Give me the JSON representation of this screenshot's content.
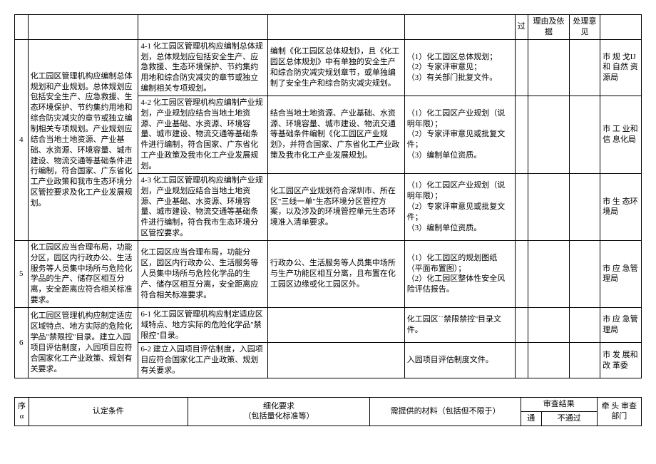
{
  "table1": {
    "head": {
      "pass": "过",
      "reason": "理由及依据",
      "opinion": "处理意见"
    },
    "rows": [
      {
        "seq": "4",
        "cond": "化工园区管理机构应编制总体规划和产业规划。总体规划应包括安全生产、应急救援、生态环境保护、节约集约用地和综合防灾减灾的章节或独立编制相关专项规划。产业规划应结合当地土地资源、产业基础、水资源、环境容量、城市建设、物流交通等基础条件进行编制，符合国家、广东省化工产业政策和我市生态环境分区管控要求及化工产业发展规划。",
        "sub": [
          {
            "detail": "4-1 化工园区管理机构应编制总体规划，总体规划应包括安全生产、应急救援、生态环境保护、节约集约用地和综合防灾减灾的章节或独立编制相关专项规划。",
            "mat": "编制《化工园区总体规划》，且《化工园区总体规划》中有单独的安全生产和综合防灾减灾规划章节，或单独编制了安全生产和综合防灾减灾规划。",
            "mat2": "（1）化工园区总体规划；\n（2）专家评审意见；\n（3）有关部门批复文件。",
            "dept": "市 规 戈IJ 和 自然 资 源局"
          },
          {
            "detail": "4-2 化工园区管理机构应编制产业规划，产业规划应结合当地土地资源、产业基础、水资源、环境容量、城市建设、物流交通等基础条件进行编制，符合国家、广东省化工产业政策及我市化工产业发展规划。",
            "mat": "结合当地土地资源、产业基础、水资源、环境容量、城市建设、物流交通等基础条件编制《化工园区产业规划》，并符合国家、广东省化工产业政策及我市化工产业发展规划。",
            "mat2": "（1）化工园区产业规划（说明年限）；\n（2）专家评审意见或批复文件；\n（3）编制单位资质。",
            "dept": "市 工 业和 信 息化局"
          },
          {
            "detail": "4-3 化工园区管理机构应编制产业规划，产业规划应结合当地土地资源、产业基础、水资源、环境容量、城市建设、物流交通等基础条件进行编制，符合我市生态环境分区管控要求。",
            "mat": "化工园区产业规划符合深圳市、所在区\"三线一单\"生态环境分区管控方案，以及涉及的环境管控单元生态环境准入清单要求。",
            "mat2": "（1）化工园区产业规划（说明年限）；\n（2）专家评审意见或批复文件；\n（3）编制单位资质。",
            "dept": "市 生 态环境局"
          }
        ]
      },
      {
        "seq": "5",
        "cond": "化工园区应当合理布局，功能分区，园区内行政办公、生活服务等人员集中场所与危险化学品的生产、储存区相互分离，安全距离应符合相关标准要求。",
        "detail": "化工园区应当合理布局，功能分区，园区内行政办公、生活服务等人员集中场所与危险化学品的生产、储存区相互分离，安全距离应符合相关标准要求。",
        "mat": "行政办公、生活服务等人员集中场所与生产功能区相互分离，且布置在化工园区边缘或化工园区外。",
        "mat2": "（1）化工园区的规划图纸（平面布置图）；\n（2）化工园区整体性安全风险评估报告。",
        "dept": "市 应 急管理局"
      },
      {
        "seq": "6",
        "cond": "化工园区管理机构应制定适应区域特点、地方实际的危险化学品\"禁限控\"目录。建立入园项目评估制度，入园项目应符合国家化工产业政策、规划有关要求。",
        "sub": [
          {
            "detail": "6-1 化工园区管理机构应制定适应区域特点、地方实际的危险化学品\"禁限控\"目录。",
            "mat": "",
            "mat2": "化工园区``禁限禁控''目录文件。",
            "dept": "市 应 急管理局"
          },
          {
            "detail": "6-2 建立入园项目评估制度，入园项目应符合国家化工产业政策、规划有关要求。",
            "mat": "",
            "mat2": "入园项目评估制度文件。",
            "dept": "市 发 展和 改 革委"
          }
        ]
      }
    ]
  },
  "table2": {
    "seq": "序\nα",
    "cond": "认定条件",
    "detail": "细化要求\n（包括量化标准等）",
    "mat": "需提供的材料（包括但不限于）",
    "result": "审查结果",
    "pass": "通",
    "fail": "不通过",
    "dept": "牵 头 审查部门"
  }
}
